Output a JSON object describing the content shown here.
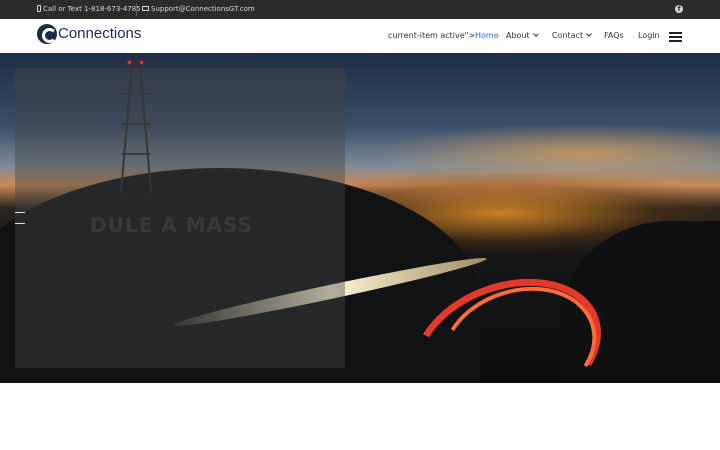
{
  "topbar": {
    "phone": "Call or Text 1-818-673-4785",
    "email": "Support@ConnectionsGT.com",
    "phone_icon": "phone-icon",
    "email_icon": "envelope-icon",
    "social_icon": "facebook-icon",
    "social_glyph": "f"
  },
  "header": {
    "logo_text": "Connections",
    "nav": {
      "home_prefix": "current-item active\">",
      "home": "Home",
      "about": "About",
      "contact": "Contact",
      "faqs": "FAQs",
      "login": "Login"
    },
    "menu_icon": "hamburger-menu-icon"
  },
  "hero": {
    "ghost_text": "DULE A MASS"
  },
  "colors": {
    "topbar_bg": "#2b2b2b",
    "brand": "#1c2b4a",
    "nav_active": "#1e6fd0"
  }
}
